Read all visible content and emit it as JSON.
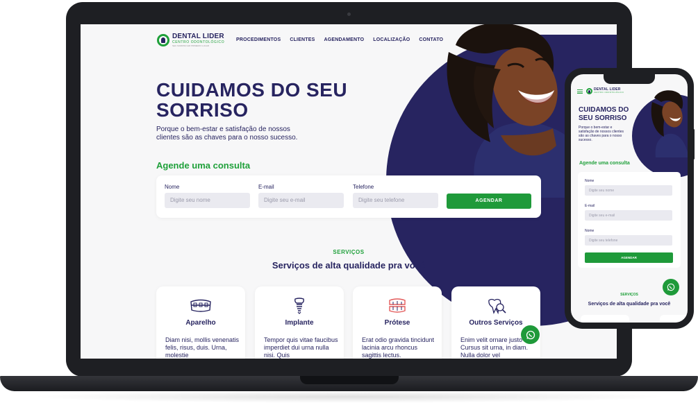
{
  "brand": {
    "name": "DENTAL LIDER",
    "subtitle": "CENTRO ODONTOLÓGICO",
    "tagline": "SEU SORRISO EM PRIMEIRO LUGAR"
  },
  "nav": [
    {
      "label": "PROCEDIMENTOS"
    },
    {
      "label": "CLIENTES"
    },
    {
      "label": "AGENDAMENTO"
    },
    {
      "label": "LOCALIZAÇÃO"
    },
    {
      "label": "CONTATO"
    }
  ],
  "hero": {
    "title": "CUIDAMOS DO SEU SORRISO",
    "subtitle": "Porque o bem-estar e satisfação de nossos clientes são as chaves para o nosso sucesso."
  },
  "form": {
    "title": "Agende uma consulta",
    "name_label": "Nome",
    "name_placeholder": "Digite seu nome",
    "email_label": "E-mail",
    "email_placeholder": "Digite seu e-mail",
    "phone_label": "Telefone",
    "phone_placeholder": "Digite seu telefone",
    "submit_label": "AGENDAR"
  },
  "services": {
    "tag": "SERVIÇOS",
    "title": "Serviços de alta qualidade pra você",
    "items": [
      {
        "title": "Aparelho",
        "text": "Diam nisi, mollis venenatis felis, risus, duis. Urna, molestie",
        "icon": "braces-icon"
      },
      {
        "title": "Implante",
        "text": "Tempor quis vitae faucibus imperdiet dui urna nulla nisi. Quis",
        "icon": "implant-icon"
      },
      {
        "title": "Prótese",
        "text": "Erat odio gravida tincidunt lacinia arcu rhoncus sagittis lectus.",
        "icon": "denture-icon"
      },
      {
        "title": "Outros Serviços",
        "text": "Enim velit ornare justo leo. Cursus sit urna, in diam. Nulla dolor vel",
        "icon": "tooth-search-icon"
      }
    ]
  },
  "colors": {
    "navy": "#272460",
    "green": "#1f9a3a",
    "background": "#f7f7f8"
  }
}
